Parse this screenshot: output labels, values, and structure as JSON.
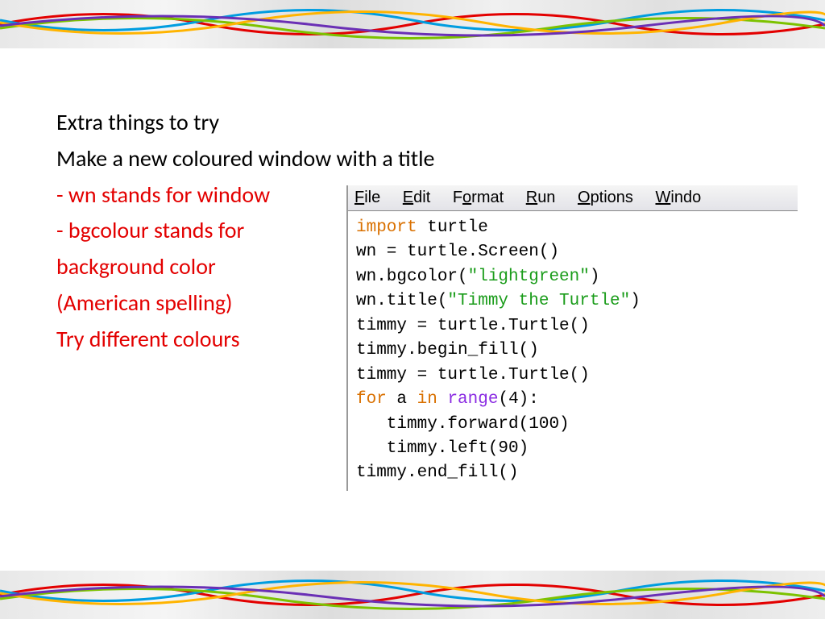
{
  "slide": {
    "title": "Extra things to try",
    "subtitle": "Make a new coloured window with a title",
    "notes": {
      "line1": "- wn stands for window",
      "line2": "- bgcolour stands for",
      "line3": "background color",
      "line4": "(American spelling)",
      "line5": "Try different colours"
    }
  },
  "editor": {
    "menu": {
      "file": "File",
      "edit": "Edit",
      "format": "Format",
      "run": "Run",
      "options": "Options",
      "window": "Window"
    },
    "code": {
      "l1_kw": "import",
      "l1_rest": " turtle",
      "l2": "wn = turtle.Screen()",
      "l3_pre": "wn.bgcolor(",
      "l3_str": "\"lightgreen\"",
      "l3_post": ")",
      "l4_pre": "wn.title(",
      "l4_str": "\"Timmy the Turtle\"",
      "l4_post": ")",
      "l5": "timmy = turtle.Turtle()",
      "l6": "timmy.begin_fill()",
      "l7": "timmy = turtle.Turtle()",
      "l8_for": "for",
      "l8_a": " a ",
      "l8_in": "in",
      "l8_range": " range",
      "l8_rest": "(4):",
      "l9": "   timmy.forward(100)",
      "l10": "   timmy.left(90)",
      "l11": "timmy.end_fill()"
    }
  }
}
